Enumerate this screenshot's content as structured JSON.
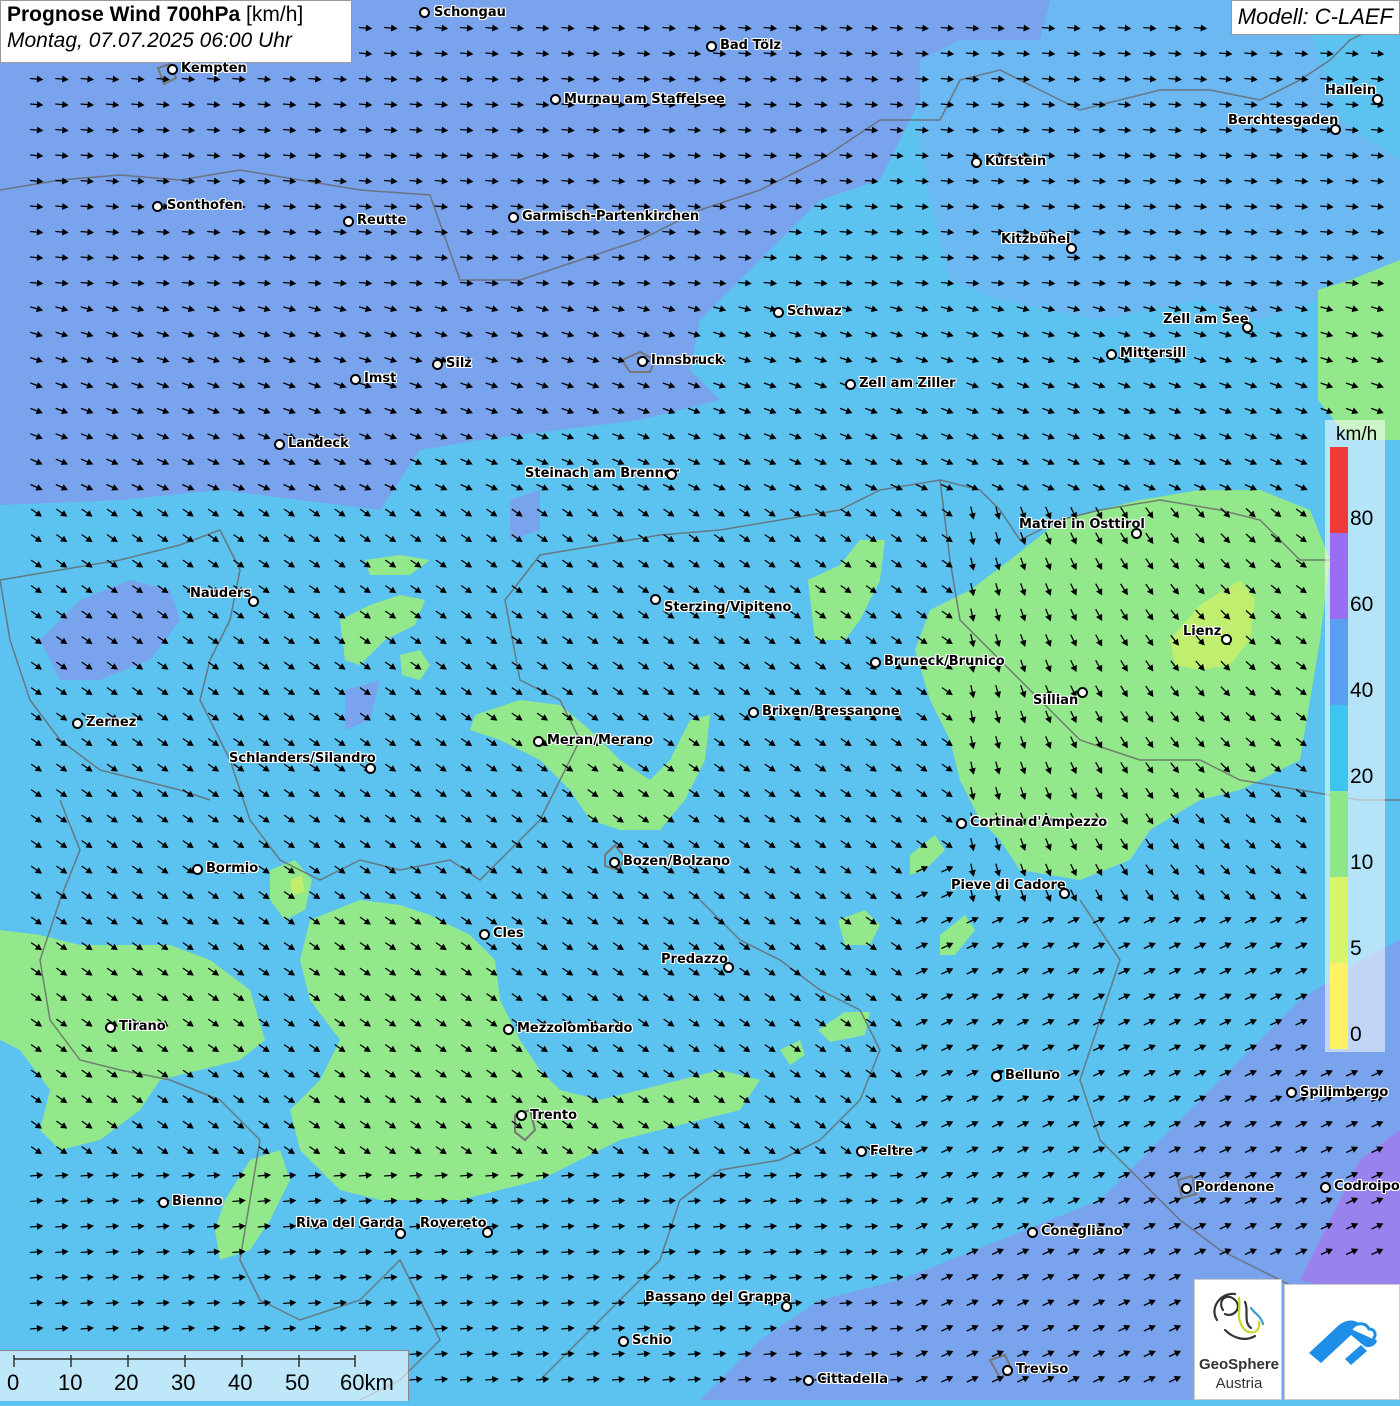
{
  "header": {
    "title_bold": "Prognose Wind 700hPa",
    "title_unit": "[km/h]",
    "datetime": "Montag, 07.07.2025 06:00 Uhr",
    "model": "Modell: C-LAEF"
  },
  "legend": {
    "unit": "km/h",
    "labels": [
      "80",
      "60",
      "40",
      "20",
      "10",
      "5",
      "0"
    ],
    "colors": [
      "#f03a3a",
      "#9a6ef0",
      "#5aa0f0",
      "#3ec4f0",
      "#8ee88a",
      "#d8f56a",
      "#fff266"
    ]
  },
  "scalebar": {
    "labels": [
      "0",
      "10",
      "20",
      "30",
      "40",
      "50",
      "60km"
    ]
  },
  "logos": {
    "geosphere_line1": "GeoSphere",
    "geosphere_line2": "Austria"
  },
  "cities": [
    {
      "name": "Schongau"
    },
    {
      "name": "Bad Tölz"
    },
    {
      "name": "Kempten"
    },
    {
      "name": "Murnau am Staffelsee"
    },
    {
      "name": "Hallein"
    },
    {
      "name": "Berchtesgaden"
    },
    {
      "name": "Kufstein"
    },
    {
      "name": "Sonthofen"
    },
    {
      "name": "Reutte"
    },
    {
      "name": "Garmisch-Partenkirchen"
    },
    {
      "name": "Kitzbühel"
    },
    {
      "name": "Schwaz"
    },
    {
      "name": "Zell am See"
    },
    {
      "name": "Innsbruck"
    },
    {
      "name": "Mittersill"
    },
    {
      "name": "Silz"
    },
    {
      "name": "Imst"
    },
    {
      "name": "Zell am Ziller"
    },
    {
      "name": "Landeck"
    },
    {
      "name": "Steinach am Brenner"
    },
    {
      "name": "Matrei in Osttirol"
    },
    {
      "name": "Nauders"
    },
    {
      "name": "Sterzing/Vipiteno"
    },
    {
      "name": "Lienz"
    },
    {
      "name": "Bruneck/Brunico"
    },
    {
      "name": "Sillian"
    },
    {
      "name": "Zernez"
    },
    {
      "name": "Brixen/Bressanone"
    },
    {
      "name": "Meran/Merano"
    },
    {
      "name": "Schlanders/Silandro"
    },
    {
      "name": "Cortina d'Ampezzo"
    },
    {
      "name": "Bozen/Bolzano"
    },
    {
      "name": "Bormio"
    },
    {
      "name": "Pieve di Cadore"
    },
    {
      "name": "Cles"
    },
    {
      "name": "Predazzo"
    },
    {
      "name": "Tirano"
    },
    {
      "name": "Mezzolombardo"
    },
    {
      "name": "Belluno"
    },
    {
      "name": "Spilimbergo"
    },
    {
      "name": "Trento"
    },
    {
      "name": "Feltre"
    },
    {
      "name": "Bienno"
    },
    {
      "name": "Pordenone"
    },
    {
      "name": "Codroipo"
    },
    {
      "name": "Riva del Garda"
    },
    {
      "name": "Rovereto"
    },
    {
      "name": "Conegliano"
    },
    {
      "name": "Bassano del Grappa"
    },
    {
      "name": "Schio"
    },
    {
      "name": "Treviso"
    },
    {
      "name": "Cittadella"
    }
  ]
}
